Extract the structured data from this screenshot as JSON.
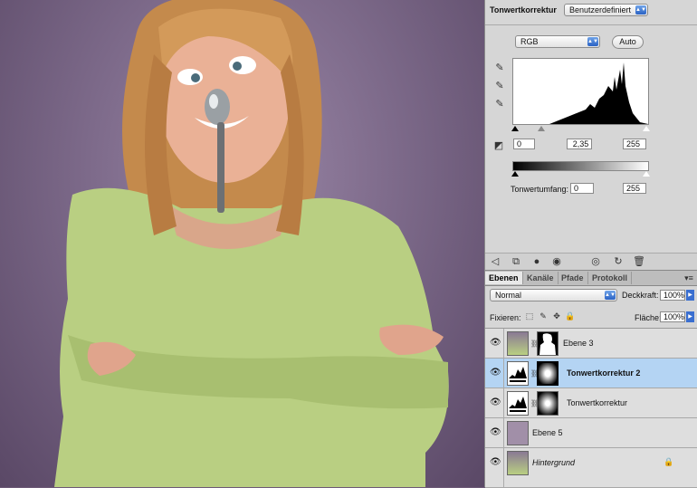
{
  "adjustments": {
    "title": "Tonwertkorrektur",
    "preset": "Benutzerdefiniert",
    "channel": "RGB",
    "auto_label": "Auto",
    "input_black": "0",
    "input_gamma": "2,35",
    "input_white": "255",
    "output_label": "Tonwertumfang:",
    "output_black": "0",
    "output_white": "255"
  },
  "tabs": [
    "Ebenen",
    "Kanäle",
    "Pfade",
    "Protokoll"
  ],
  "layers_panel": {
    "blend_mode": "Normal",
    "opacity_label": "Deckkraft:",
    "opacity_value": "100%",
    "lock_label": "Fixieren:",
    "fill_label": "Fläche:",
    "fill_value": "100%"
  },
  "layers": [
    {
      "name": "Ebene 3"
    },
    {
      "name": "Tonwertkorrektur 2"
    },
    {
      "name": "Tonwertkorrektur"
    },
    {
      "name": "Ebene 5"
    },
    {
      "name": "Hintergrund"
    }
  ],
  "colors": {
    "panel_bg": "#d6d6d6",
    "selected_layer": "#b4d4f3",
    "canvas_bg": "#7d6a8a",
    "ebene5_swatch": "#a18fa8"
  }
}
